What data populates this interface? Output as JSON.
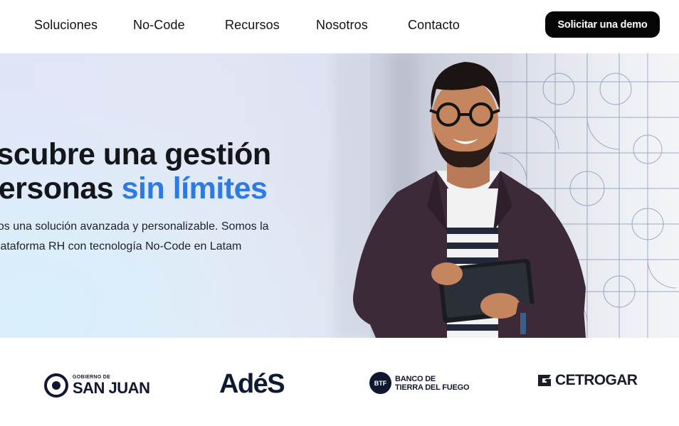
{
  "nav": {
    "items": [
      "Soluciones",
      "No-Code",
      "Recursos",
      "Nosotros",
      "Contacto"
    ],
    "cta_label": "Solicitar una demo"
  },
  "hero": {
    "title_line1": "escubre una gestión",
    "title_line2_prefix": " personas ",
    "title_line2_accent": "sin límites",
    "subtitle_line1": "nos una solución avanzada y personalizable. Somos la",
    "subtitle_line2": "plataforma RH con tecnología No-Code en Latam",
    "accent_color": "#2c7be5"
  },
  "logos": {
    "sanjuan_small": "GOBIERNO DE",
    "sanjuan_big": "SAN JUAN",
    "ades": "AdéS",
    "btf_badge": "BTF",
    "btf_line1": "BANCO DE",
    "btf_line2": "TIERRA DEL FUEGO",
    "cetrogar": "CETROGAR"
  }
}
